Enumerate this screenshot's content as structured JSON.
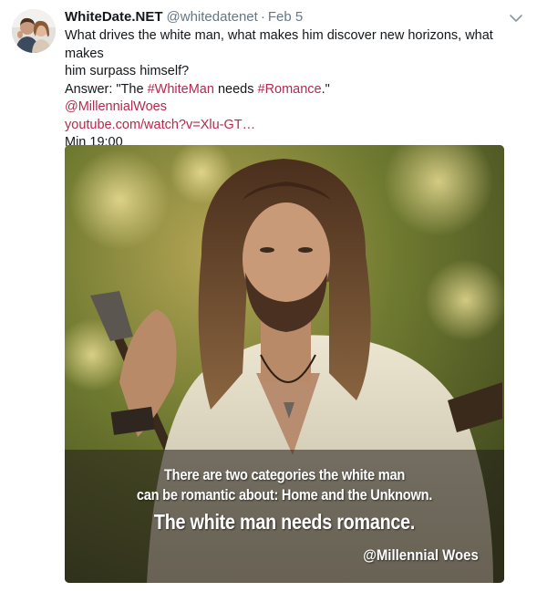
{
  "tweet": {
    "display_name": "WhiteDate.NET",
    "handle": "@whitedatenet",
    "separator": "·",
    "date": "Feb 5",
    "text_lines": [
      "What drives the white man, what makes him discover new horizons, what makes",
      "him surpass himself?"
    ],
    "answer_prefix": "Answer: \"The ",
    "hashtag1": "#WhiteMan",
    "answer_middle": " needs ",
    "hashtag2": "#Romance",
    "answer_suffix": ".\"",
    "mention": "@MillennialWoes",
    "link": "youtube.com/watch?v=Xlu-GT…",
    "timestamp": "Min 19:00",
    "menu_icon": "chevron-down-icon"
  },
  "media": {
    "caption_line1": "There are two categories the white man",
    "caption_line2": "can be romantic about: Home and the Unknown.",
    "caption_line3": "The white man needs romance.",
    "watermark": "@Millennial Woes"
  },
  "colors": {
    "link": "#b5294e",
    "secondary_text": "#657786",
    "primary_text": "#14171a"
  }
}
